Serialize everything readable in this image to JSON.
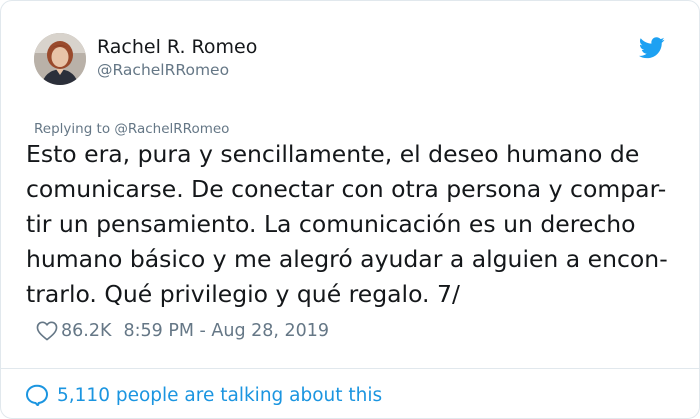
{
  "author": {
    "display_name": "Rachel R. Romeo",
    "handle": "@RachelRRomeo",
    "avatar_icon": "avatar"
  },
  "brand": {
    "icon": "twitter-bird-icon",
    "color": "#1da1f2"
  },
  "reply": {
    "text": "Replying to @RachelRRomeo"
  },
  "tweet": {
    "lines": [
      "Esto era, pura y sencillamente, el deseo humano de",
      "comunicarse. De conectar con otra persona y compar-",
      "tir un pensamiento. La comunicación es un derecho",
      "humano básico y me alegró ayudar a alguien a encon-",
      "trarlo. Qué privilegio y qué regalo. 7/"
    ]
  },
  "meta": {
    "likes_icon": "heart-icon",
    "likes": "86.2K",
    "timestamp": "8:59 PM - Aug 28, 2019"
  },
  "conversation": {
    "icon": "speech-bubble-icon",
    "text": "5,110 people are talking about this",
    "color": "#1b95e0"
  }
}
